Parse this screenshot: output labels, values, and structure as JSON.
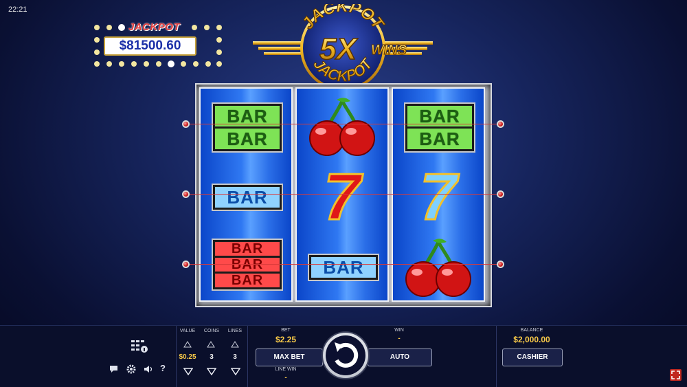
{
  "status_bar": {
    "time": "22:21"
  },
  "jackpot": {
    "title": "JACKPOT",
    "amount": "$81500.60"
  },
  "logo": {
    "top_text": "JACKPOT",
    "center_text": "5X",
    "right_text": "WINS",
    "bottom_text": "JACKPOT"
  },
  "reels": [
    {
      "symbols": [
        "double-bar-green",
        "single-bar-blue",
        "triple-bar-red"
      ]
    },
    {
      "symbols": [
        "cherry",
        "red-seven",
        "single-bar-blue"
      ]
    },
    {
      "symbols": [
        "double-bar-green",
        "blue-seven",
        "cherry"
      ]
    }
  ],
  "symbol_text": {
    "bar": "BAR",
    "seven": "7"
  },
  "controls": {
    "value_label": "VALUE",
    "value": "$0.25",
    "coins_label": "COINS",
    "coins": "3",
    "lines_label": "LINES",
    "lines": "3",
    "bet_label": "BET",
    "bet": "$2.25",
    "max_bet_label": "MAX BET",
    "line_win_label": "LINE WIN",
    "line_win": "-",
    "win_label": "WIN",
    "win": "-",
    "auto_label": "AUTO",
    "balance_label": "BALANCE",
    "balance": "$2,000.00",
    "cashier_label": "CASHIER"
  },
  "colors": {
    "payline": "#d93a3a",
    "value_text": "#f7c948",
    "accent_red": "#c1281f"
  },
  "icons": [
    "paytable-icon",
    "chat-icon",
    "settings-icon",
    "sound-icon",
    "help-icon",
    "spin-icon",
    "fullscreen-icon"
  ]
}
